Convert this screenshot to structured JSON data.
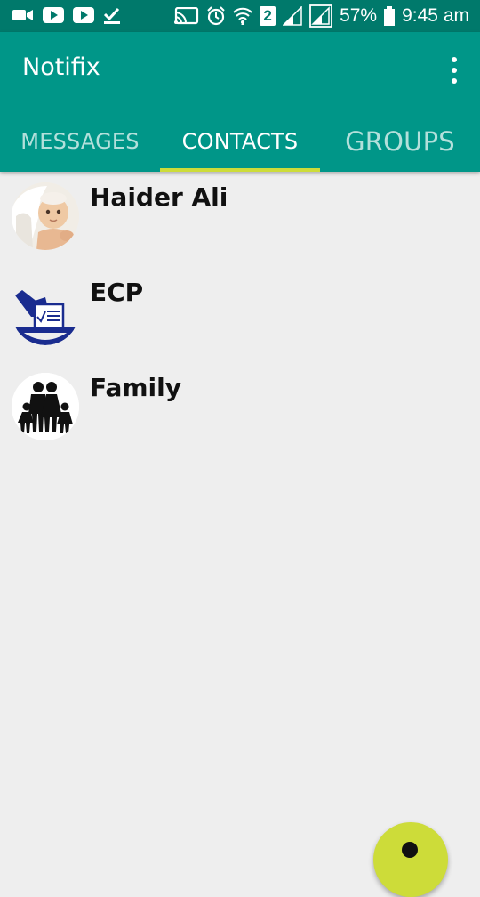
{
  "status_bar": {
    "battery": "57%",
    "time": "9:45 am",
    "sim_slot": "2",
    "icons_left": [
      "video-icon",
      "youtube-icon",
      "youtube-icon",
      "download-done-icon"
    ],
    "icons_right": [
      "cast-icon",
      "alarm-icon",
      "wifi-icon",
      "sim-2-icon",
      "signal-icon",
      "signal-icon",
      "battery-icon"
    ]
  },
  "app_bar": {
    "title": "Notifix",
    "menu_icon": "more-vert-icon"
  },
  "tabs": [
    {
      "label": "MESSAGES",
      "active": false
    },
    {
      "label": "CONTACTS",
      "active": true
    },
    {
      "label": "GROUPS",
      "active": false
    }
  ],
  "contacts": [
    {
      "name": "Haider Ali",
      "avatar": "baby-photo"
    },
    {
      "name": "ECP",
      "avatar": "ballot-box-icon"
    },
    {
      "name": "Family",
      "avatar": "family-icon"
    }
  ],
  "colors": {
    "status_bar": "#00796b",
    "primary": "#009688",
    "accent": "#cddc39",
    "background": "#eeeeee"
  }
}
